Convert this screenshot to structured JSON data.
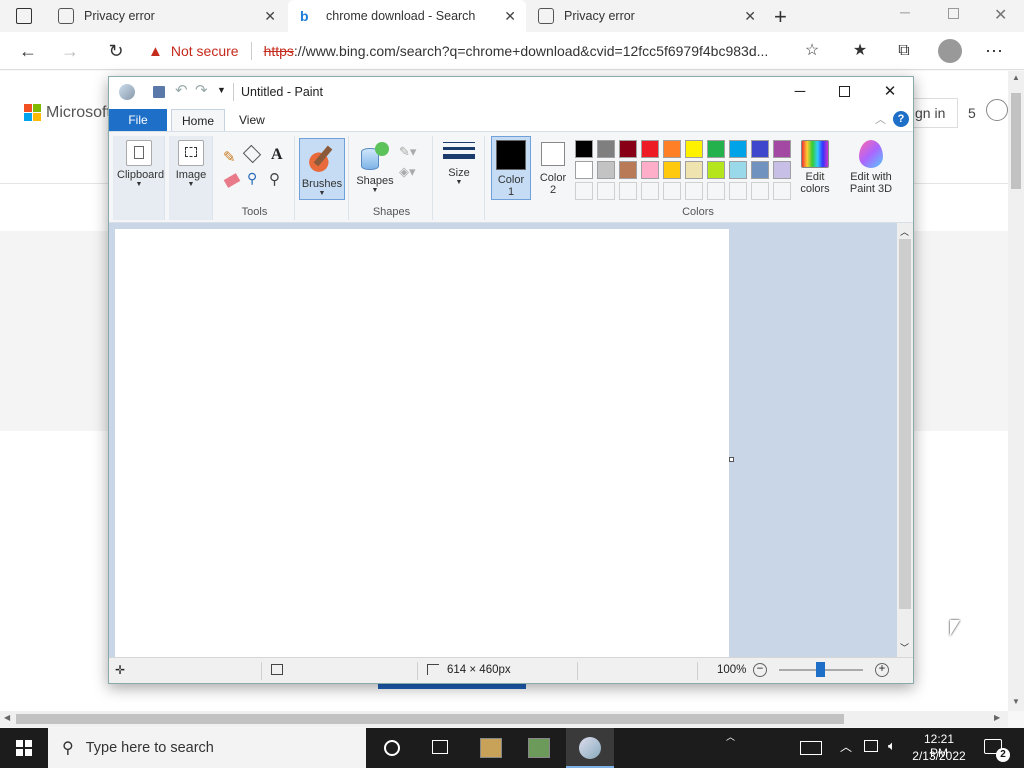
{
  "browser": {
    "tabs": [
      {
        "label": "Privacy error",
        "active": false
      },
      {
        "label": "chrome download - Search",
        "active": true
      },
      {
        "label": "Privacy error",
        "active": false
      }
    ],
    "security_label": "Not secure",
    "url_scheme": "https",
    "url_rest": "://www.bing.com/search?q=chrome+download&cvid=12fcc5f6979f4bc983d...",
    "page_brand": "Microsoft",
    "sign_in": "gn in",
    "rewards_count": "5"
  },
  "paint": {
    "title": "Untitled - Paint",
    "tabs": {
      "file": "File",
      "home": "Home",
      "view": "View"
    },
    "groups": {
      "clipboard": "Clipboard",
      "image": "Image",
      "tools": "Tools",
      "brushes": "Brushes",
      "shapes_btn": "Shapes",
      "shapes": "Shapes",
      "size": "Size",
      "color1": "Color\n1",
      "color2": "Color\n2",
      "colors": "Colors",
      "edit_colors": "Edit\ncolors",
      "paint3d": "Edit with\nPaint 3D"
    },
    "palette_row1": [
      "#000000",
      "#7f7f7f",
      "#880015",
      "#ed1c24",
      "#ff7f27",
      "#fff200",
      "#22b14c",
      "#00a2e8",
      "#3f48cc",
      "#a349a4"
    ],
    "palette_row2": [
      "#ffffff",
      "#c3c3c3",
      "#b97a57",
      "#ffaec9",
      "#ffc90e",
      "#efe4b0",
      "#b5e61d",
      "#99d9ea",
      "#7092be",
      "#c8bfe7"
    ],
    "color1": "#000000",
    "color2": "#ffffff",
    "status": {
      "size": "614 × 460px",
      "zoom": "100%"
    }
  },
  "taskbar": {
    "search_placeholder": "Type here to search",
    "time": "12:21 PM",
    "date": "2/13/2022",
    "notifications": "2"
  }
}
